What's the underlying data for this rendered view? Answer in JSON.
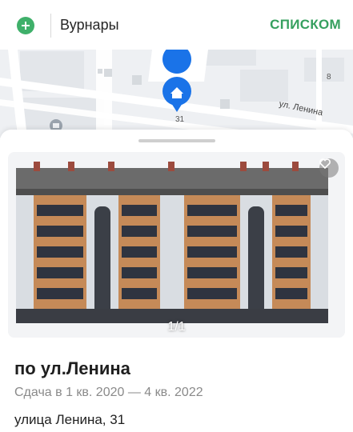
{
  "header": {
    "add_icon": "plus-circle-icon",
    "city": "Вурнары",
    "view_toggle_label": "СПИСКОМ",
    "accent_color": "#36a05f"
  },
  "map": {
    "street_label": "ул. Ленина",
    "house_number": "31",
    "other_house_number": "8",
    "pin_icon": "home-pin-icon",
    "pin_color": "#1a73e8"
  },
  "card": {
    "photo_counter": "1/1",
    "favorite_icon": "heart-icon",
    "title": "по ул.Ленина",
    "completion": "Сдача в 1 кв. 2020 — 4 кв. 2022",
    "address": "улица Ленина, 31"
  }
}
